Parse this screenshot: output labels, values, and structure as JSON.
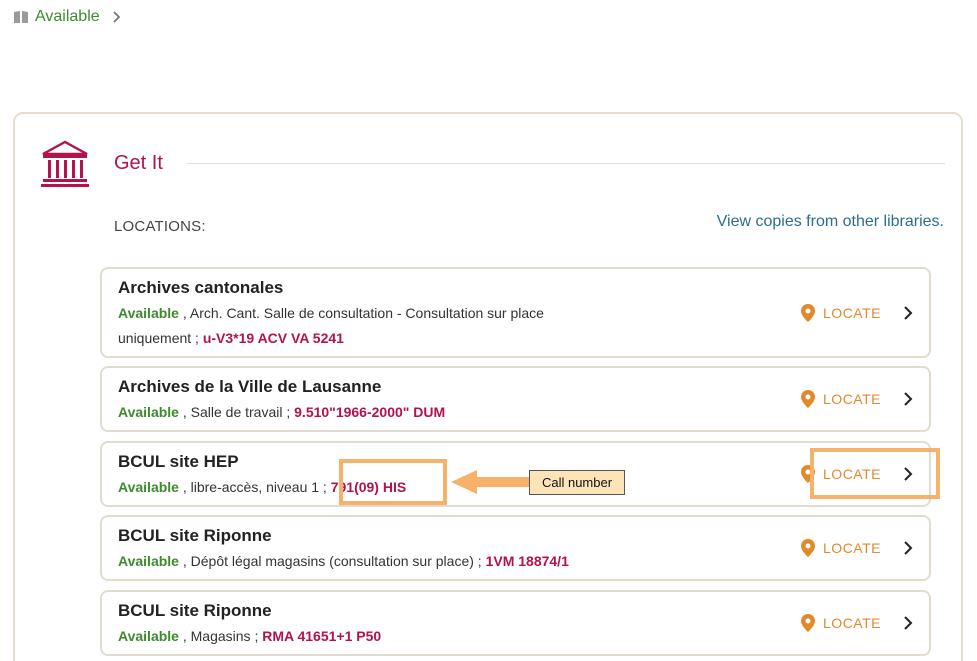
{
  "availability_link": {
    "label": "Available",
    "icon": "book-icon"
  },
  "get_it": {
    "title": "Get It",
    "icon": "institution-icon",
    "locations_label": "LOCATIONS:",
    "view_copies_link": "View copies from other libraries."
  },
  "locations": [
    {
      "name": "Archives cantonales",
      "status": "Available",
      "sep1": " , ",
      "detail": "Arch. Cant. Salle de consultation - Consultation sur place uniquement",
      "sep2": " ; ",
      "call_number": "u-V3*19 ACV VA 5241",
      "locate": "LOCATE"
    },
    {
      "name": "Archives de la Ville de Lausanne",
      "status": "Available",
      "sep1": " , ",
      "detail": "Salle de travail",
      "sep2": " ; ",
      "call_number": "9.510\"1966-2000\" DUM",
      "locate": "LOCATE"
    },
    {
      "name": "BCUL site HEP",
      "status": "Available",
      "sep1": " , ",
      "detail": "libre-accès, niveau 1",
      "sep2": " ; ",
      "call_number": "791(09) HIS",
      "locate": "LOCATE"
    },
    {
      "name": "BCUL site Riponne",
      "status": "Available",
      "sep1": " , ",
      "detail": "Dépôt légal magasins (consultation sur place)",
      "sep2": " ; ",
      "call_number": "1VM 18874/1",
      "locate": "LOCATE"
    },
    {
      "name": "BCUL site Riponne",
      "status": "Available",
      "sep1": " , ",
      "detail": "Magasins",
      "sep2": " ; ",
      "call_number": "RMA 41651+1 P50",
      "locate": "LOCATE"
    }
  ],
  "annotation": {
    "callout_label": "Call number",
    "highlight_color": "#f6b26b"
  },
  "colors": {
    "accent": "#b3124e",
    "available": "#3d8a2f",
    "locate": "#e08a2c",
    "link": "#2c6e8a"
  }
}
